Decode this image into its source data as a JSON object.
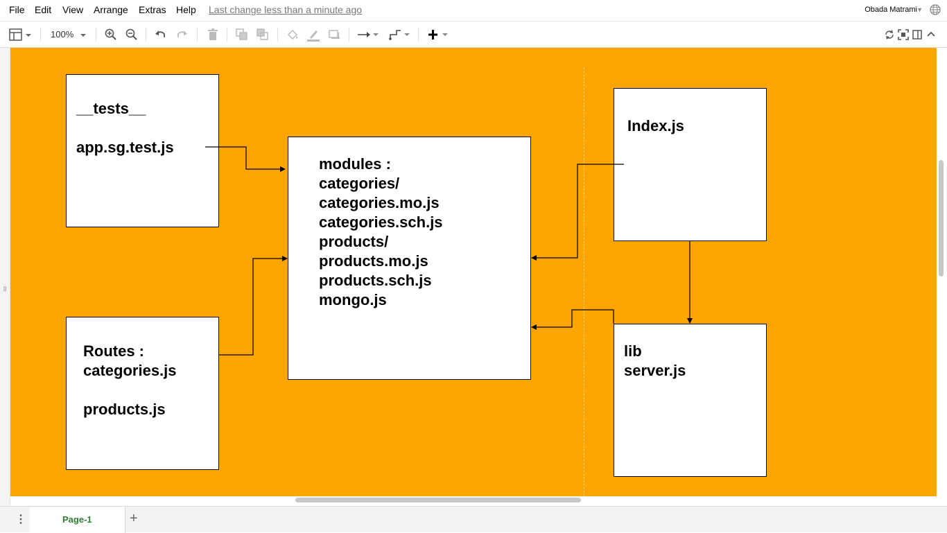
{
  "menu": {
    "items": [
      "File",
      "Edit",
      "View",
      "Arrange",
      "Extras",
      "Help"
    ],
    "last_change": "Last change less than a minute ago",
    "user_name": "Obada Matrami"
  },
  "toolbar": {
    "zoom": "100%"
  },
  "diagram": {
    "tests_box": "__tests__\n\napp.sg.test.js",
    "modules_box": "modules :\ncategories/\ncategories.mo.js\ncategories.sch.js\nproducts/\nproducts.mo.js\nproducts.sch.js\nmongo.js",
    "routes_box": "Routes :\ncategories.js\n\nproducts.js",
    "index_box": "Index.js",
    "lib_box": "lib\nserver.js",
    "background_color": "#ffa500"
  },
  "pages": {
    "tabs": [
      "Page-1"
    ],
    "active_tab_color": "#2e7d32"
  }
}
